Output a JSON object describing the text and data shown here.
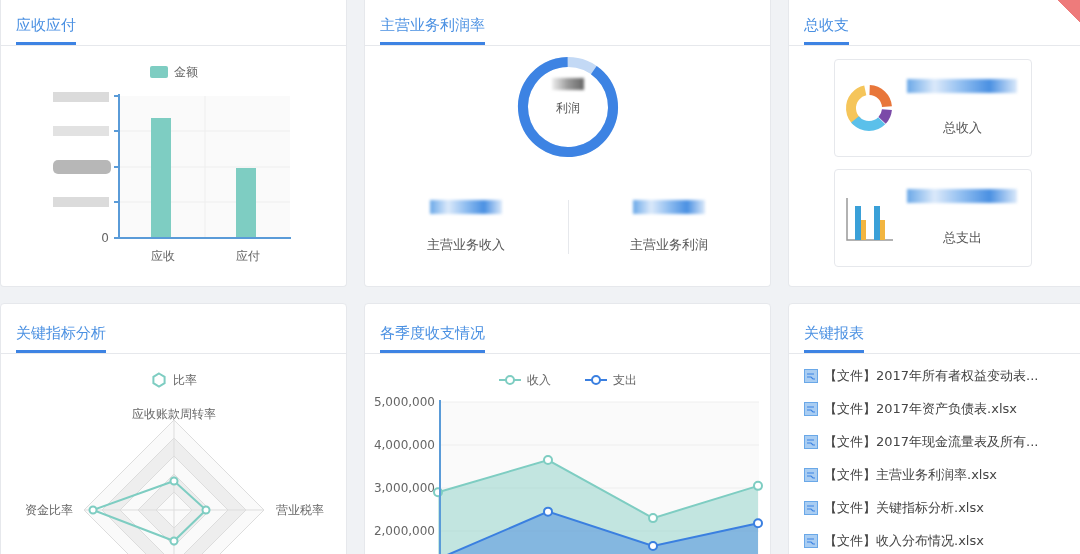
{
  "receivables": {
    "title": "应收应付",
    "legend": "金额",
    "y_tick": "0",
    "categories": [
      "应收",
      "应付"
    ]
  },
  "profit_margin": {
    "title": "主营业务利润率",
    "center_label": "利润",
    "level": 0.9,
    "stats": [
      {
        "label": "主营业务收入"
      },
      {
        "label": "主营业务利润"
      }
    ]
  },
  "totals": {
    "title": "总收支",
    "cards": [
      {
        "kind": "donut",
        "label": "总收入"
      },
      {
        "kind": "bars",
        "label": "总支出"
      }
    ]
  },
  "key_indicators": {
    "title": "关键指标分析",
    "legend": "比率",
    "axes": [
      "应收账款周转率",
      "营业税率",
      "资金比率"
    ]
  },
  "quarterly": {
    "title": "各季度收支情况",
    "chart_data": {
      "type": "area",
      "grid": true,
      "ylim": [
        1000000,
        5000000
      ],
      "yticks": [
        {
          "value": 2000000,
          "label": "2,000,000"
        },
        {
          "value": 3000000,
          "label": "3,000,000"
        },
        {
          "value": 4000000,
          "label": "4,000,000"
        },
        {
          "value": 5000000,
          "label": "5,000,000"
        }
      ],
      "series": [
        {
          "name": "收入",
          "color": "#7ecdc2",
          "values": [
            2900000,
            3650000,
            2300000,
            3050000
          ]
        },
        {
          "name": "支出",
          "color": "#3a7fe0",
          "values": [
            1350000,
            2450000,
            1650000,
            2180000
          ]
        }
      ]
    }
  },
  "reports": {
    "title": "关键报表",
    "files": [
      "【文件】2017年所有者权益变动表...",
      "【文件】2017年资产负债表.xlsx",
      "【文件】2017年现金流量表及所有...",
      "【文件】主营业务利润率.xlsx",
      "【文件】关键指标分析.xlsx",
      "【文件】收入分布情况.xlsx"
    ]
  }
}
